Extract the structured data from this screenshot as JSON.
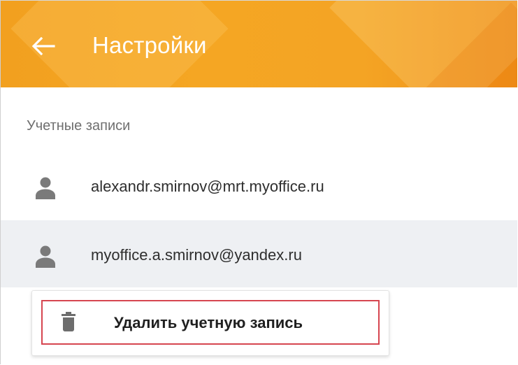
{
  "appbar": {
    "title": "Настройки",
    "back_icon": "arrow-left-icon",
    "colors": {
      "primary": "#f5a623",
      "text": "#ffffff"
    }
  },
  "accounts_section": {
    "header": "Учетные записи",
    "accounts": [
      {
        "email": "alexandr.smirnov@mrt.myoffice.ru",
        "icon": "person-icon",
        "selected": false
      },
      {
        "email": "myoffice.a.smirnov@yandex.ru",
        "icon": "person-icon",
        "selected": true
      }
    ]
  },
  "context_menu": {
    "delete_label": "Удалить учетную запись",
    "delete_icon": "trash-icon",
    "highlight_color": "#d64550"
  }
}
